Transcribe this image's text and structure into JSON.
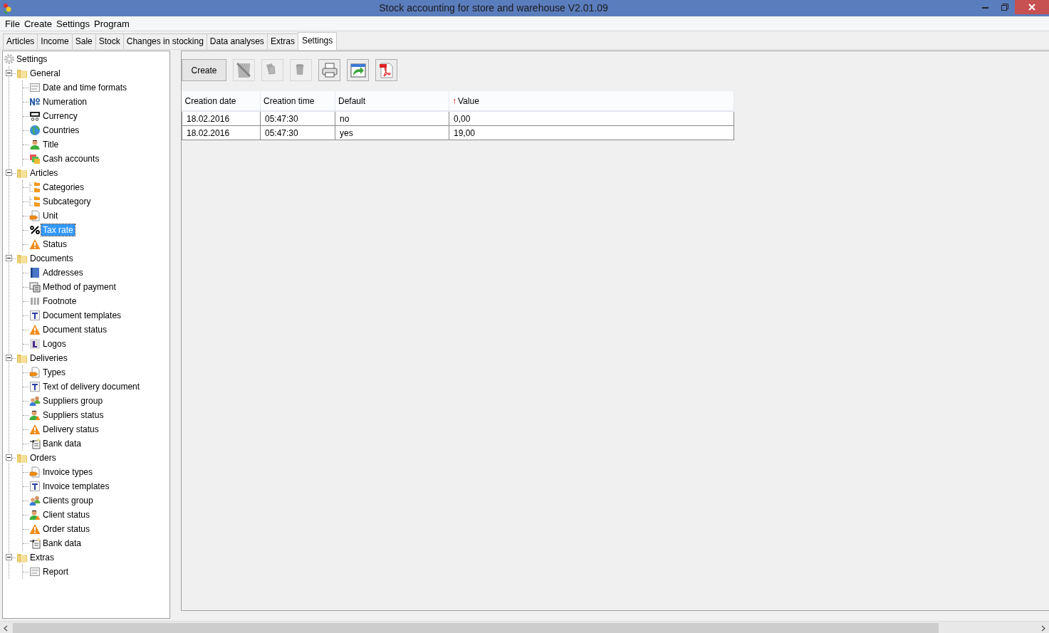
{
  "window": {
    "title": "Stock accounting for store and warehouse V2.01.09"
  },
  "menu": [
    "File",
    "Create",
    "Settings",
    "Program"
  ],
  "tabs": [
    {
      "label": "Articles",
      "selected": false
    },
    {
      "label": "Income",
      "selected": false
    },
    {
      "label": "Sale",
      "selected": false
    },
    {
      "label": "Stock",
      "selected": false
    },
    {
      "label": "Changes in stocking",
      "selected": false
    },
    {
      "label": "Data analyses",
      "selected": false
    },
    {
      "label": "Extras",
      "selected": false
    },
    {
      "label": "Settings",
      "selected": true
    }
  ],
  "tree": {
    "label": "Settings",
    "kind": "gear",
    "selected": false,
    "children": [
      {
        "label": "General",
        "kind": "folder",
        "selected": false,
        "expanded": true,
        "children": [
          {
            "label": "Date and time formats",
            "kind": "form",
            "selected": false
          },
          {
            "label": "Numeration",
            "kind": "numero",
            "selected": false
          },
          {
            "label": "Currency",
            "kind": "currency",
            "selected": false
          },
          {
            "label": "Countries",
            "kind": "globe",
            "selected": false
          },
          {
            "label": "Title",
            "kind": "person",
            "selected": false
          },
          {
            "label": "Cash accounts",
            "kind": "cash",
            "selected": false
          }
        ]
      },
      {
        "label": "Articles",
        "kind": "folder",
        "selected": false,
        "expanded": true,
        "children": [
          {
            "label": "Categories",
            "kind": "subfolders",
            "selected": false
          },
          {
            "label": "Subcategory",
            "kind": "subfolders",
            "selected": false
          },
          {
            "label": "Unit",
            "kind": "tag",
            "selected": false
          },
          {
            "label": "Tax rate",
            "kind": "percent",
            "selected": true
          },
          {
            "label": "Status",
            "kind": "warning",
            "selected": false
          }
        ]
      },
      {
        "label": "Documents",
        "kind": "folder",
        "selected": false,
        "expanded": true,
        "children": [
          {
            "label": "Addresses",
            "kind": "book",
            "selected": false
          },
          {
            "label": "Method of payment",
            "kind": "payment",
            "selected": false
          },
          {
            "label": "Footnote",
            "kind": "footnote",
            "selected": false
          },
          {
            "label": "Document templates",
            "kind": "text",
            "selected": false
          },
          {
            "label": "Document status",
            "kind": "warning",
            "selected": false
          },
          {
            "label": "Logos",
            "kind": "logo",
            "selected": false
          }
        ]
      },
      {
        "label": "Deliveries",
        "kind": "folder",
        "selected": false,
        "expanded": true,
        "children": [
          {
            "label": "Types",
            "kind": "tag",
            "selected": false
          },
          {
            "label": "Text of delivery document",
            "kind": "text",
            "selected": false
          },
          {
            "label": "Suppliers group",
            "kind": "group",
            "selected": false
          },
          {
            "label": "Suppliers status",
            "kind": "person_warning",
            "selected": false
          },
          {
            "label": "Delivery status",
            "kind": "warning",
            "selected": false
          },
          {
            "label": "Bank data",
            "kind": "bank",
            "selected": false
          }
        ]
      },
      {
        "label": "Orders",
        "kind": "folder",
        "selected": false,
        "expanded": true,
        "children": [
          {
            "label": "Invoice types",
            "kind": "tag",
            "selected": false
          },
          {
            "label": "Invoice templates",
            "kind": "text",
            "selected": false
          },
          {
            "label": "Clients group",
            "kind": "group",
            "selected": false
          },
          {
            "label": "Client status",
            "kind": "person_warning",
            "selected": false
          },
          {
            "label": "Order status",
            "kind": "warning",
            "selected": false
          },
          {
            "label": "Bank data",
            "kind": "bank",
            "selected": false
          }
        ]
      },
      {
        "label": "Extras",
        "kind": "folder",
        "selected": false,
        "expanded": true,
        "children": [
          {
            "label": "Report",
            "kind": "form",
            "selected": false
          }
        ]
      }
    ]
  },
  "toolbar": [
    {
      "kind": "text",
      "label": "Create",
      "disabled": false
    },
    {
      "kind": "edit",
      "disabled": true
    },
    {
      "kind": "copy",
      "disabled": true
    },
    {
      "kind": "delete",
      "disabled": true
    },
    {
      "kind": "print",
      "disabled": false
    },
    {
      "kind": "export",
      "disabled": false
    },
    {
      "kind": "pdf",
      "disabled": false
    }
  ],
  "table": {
    "columns": [
      {
        "label": "Creation date"
      },
      {
        "label": "Creation time"
      },
      {
        "label": "Default"
      },
      {
        "label": "Value",
        "sort_mark": "↑"
      }
    ],
    "rows": [
      {
        "cells": [
          "18.02.2016",
          "05:47:30",
          "no",
          "0,00"
        ]
      },
      {
        "cells": [
          "18.02.2016",
          "05:47:30",
          "yes",
          "19,00"
        ]
      }
    ]
  }
}
